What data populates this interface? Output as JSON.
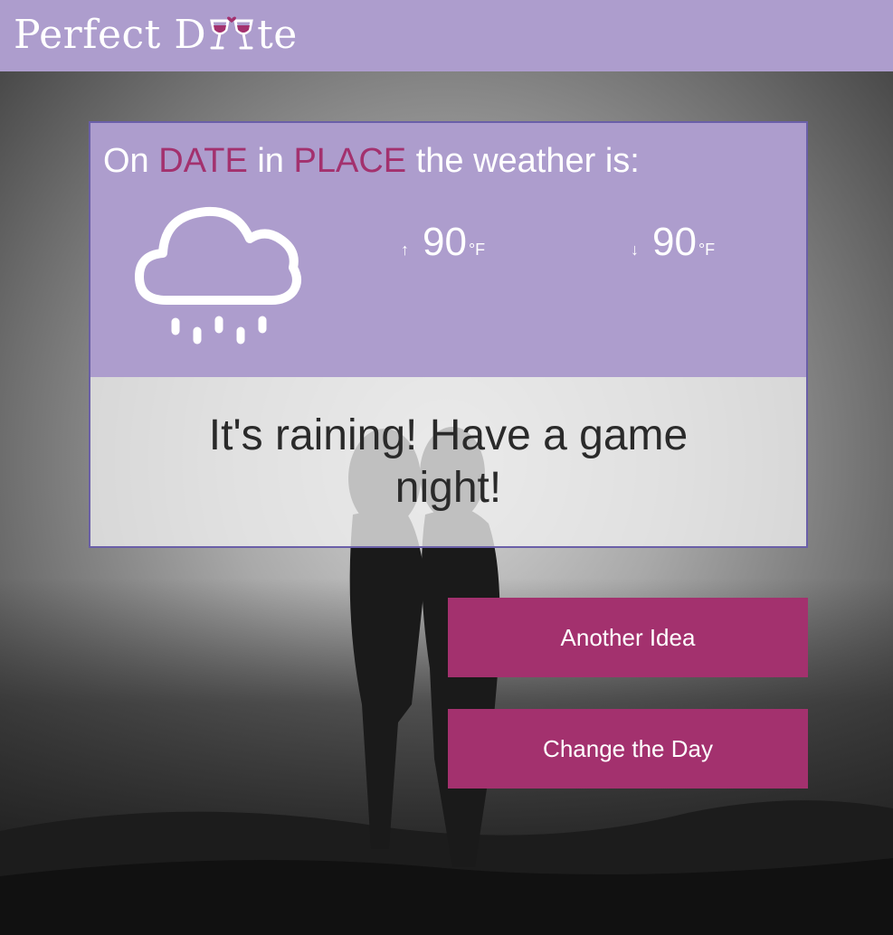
{
  "header": {
    "brand_part1": "Perfect D",
    "brand_part2": "te",
    "brand_icon": "wine-glasses-icon",
    "background_color": "#ad9dcd"
  },
  "weather_card": {
    "intro_on": "On",
    "date_placeholder": "DATE",
    "intro_in": "in",
    "place_placeholder": "PLACE",
    "intro_tail": "the weather is:",
    "icon": "rain-cloud-icon",
    "high": {
      "arrow": "↑",
      "value": "90",
      "unit": "°F"
    },
    "low": {
      "arrow": "↓",
      "value": "90",
      "unit": "°F"
    },
    "suggestion": "It's raining! Have a game night!",
    "accent_color": "#a3316e"
  },
  "actions": {
    "another_idea_label": "Another Idea",
    "change_day_label": "Change the Day",
    "button_color": "#a3316e"
  }
}
